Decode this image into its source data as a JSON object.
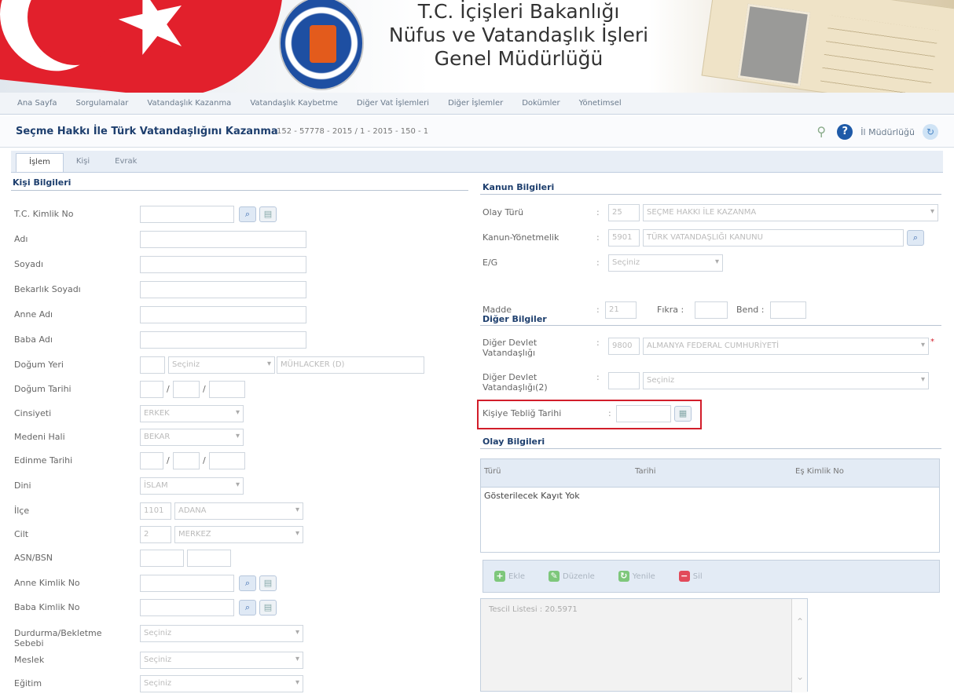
{
  "banner": {
    "title_lines": [
      "T.C. İçişleri Bakanlığı",
      "Nüfus ve Vatandaşlık İşleri",
      "Genel Müdürlüğü"
    ]
  },
  "menu": {
    "items": [
      "Ana Sayfa",
      "Sorgulamalar",
      "Vatandaşlık Kazanma",
      "Vatandaşlık Kaybetme",
      "Diğer Vat İşlemleri",
      "Diğer İşlemler",
      "Dokümler",
      "Yönetimsel"
    ]
  },
  "header": {
    "title": "Seçme Hakkı İle Türk Vatandaşlığını Kazanma",
    "subtitle": "152 - 57778 - 2015 / 1 - 2015 - 150 - 1",
    "unit_label": "İl Müdürlüğü"
  },
  "tabs": [
    "İşlem",
    "Kişi",
    "Evrak"
  ],
  "left": {
    "section_title": "Kişi Bilgileri",
    "rows": [
      {
        "label": "T.C. Kimlik No",
        "value": ""
      },
      {
        "label": "Adı",
        "value": ""
      },
      {
        "label": "Soyadı",
        "value": ""
      },
      {
        "label": "Bekarlık Soyadı",
        "value": ""
      },
      {
        "label": "Anne Adı",
        "value": ""
      },
      {
        "label": "Baba Adı",
        "value": ""
      },
      {
        "label": "Doğum Yeri",
        "value": "Seçiniz",
        "extra": "MÜHLACKER (D)"
      },
      {
        "label": "Doğum Tarihi",
        "value": ""
      },
      {
        "label": "Cinsiyeti",
        "value": "ERKEK"
      },
      {
        "label": "Medeni Hali",
        "value": "BEKAR"
      },
      {
        "label": "Edinme Tarihi",
        "value": ""
      },
      {
        "label": "Dini",
        "value": "İSLAM"
      },
      {
        "label": "İlçe",
        "value": "1101",
        "extra": "ADANA"
      },
      {
        "label": "Cilt",
        "value": "2",
        "extra": "MERKEZ"
      },
      {
        "label": "ASN/BSN",
        "value": ""
      },
      {
        "label": "Anne Kimlik No",
        "value": ""
      },
      {
        "label": "Baba Kimlik No",
        "value": ""
      },
      {
        "label": "Durdurma/Bekletme Sebebi",
        "value": "Seçiniz"
      },
      {
        "label": "Meslek",
        "value": "Seçiniz"
      },
      {
        "label": "Eğitim",
        "value": "Seçiniz"
      }
    ]
  },
  "right": {
    "law_title": "Kanun Bilgileri",
    "olay_turu": {
      "label": "Olay Türü",
      "code": "25",
      "value": "SEÇME HAKKI İLE KAZANMA"
    },
    "kanun": {
      "label": "Kanun-Yönetmelik",
      "code": "5901",
      "value": "TÜRK VATANDAŞLIĞI KANUNU"
    },
    "eg": {
      "label": "E/G",
      "value": "Seçiniz"
    },
    "madde": {
      "label": "Madde",
      "value": "21",
      "fikra_label": "Fıkra :",
      "bend_label": "Bend :"
    },
    "other_title": "Diğer Bilgiler",
    "diger1": {
      "label": "Diğer Devlet Vatandaşlığı",
      "code": "9800",
      "value": "ALMANYA FEDERAL CUMHURİYETİ"
    },
    "diger2": {
      "label": "Diğer Devlet Vatandaşlığı(2)",
      "value": "Seçiniz"
    },
    "kisiye": {
      "label": "Kişiye Tebliğ Tarihi",
      "value": ""
    },
    "events_title": "Olay Bilgileri",
    "events_cols": [
      "Türü",
      "Tarihi",
      "Eş Kimlik No"
    ],
    "events_empty": "Gösterilecek Kayıt Yok",
    "actions": [
      "Ekle",
      "Düzenle",
      "Yenile",
      "Sil"
    ],
    "notes_text": "Tescil Listesi : 20.5971"
  },
  "colors": {
    "accent": "#1e3f6e",
    "highlight": "#d21d2a"
  }
}
